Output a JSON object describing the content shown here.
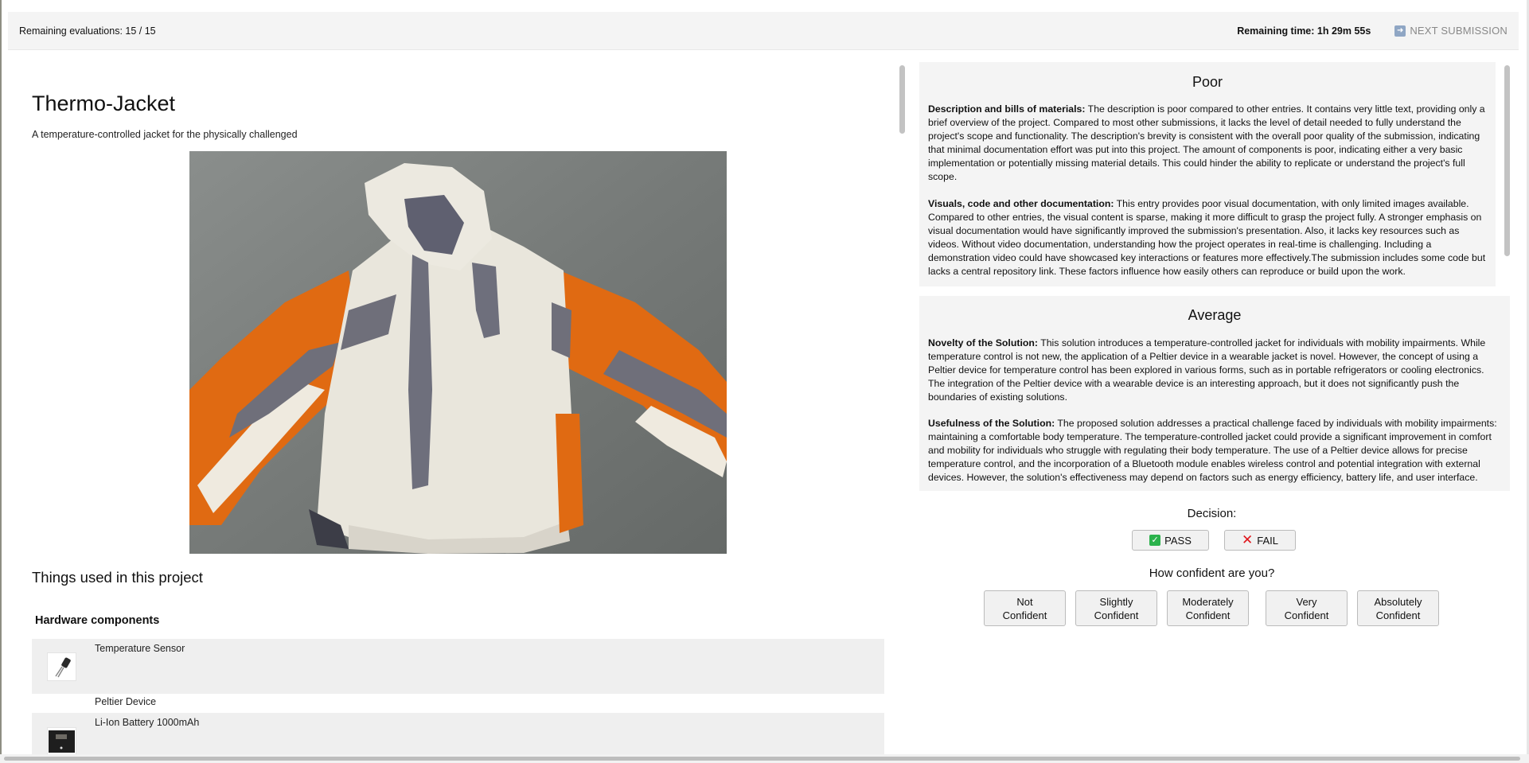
{
  "topbar": {
    "remaining_evaluations": "Remaining evaluations: 15 / 15",
    "remaining_time": "Remaining time: 1h 29m 55s",
    "next_submission": "NEXT SUBMISSION",
    "next_icon": "arrow-right-icon"
  },
  "project": {
    "title": "Thermo-Jacket",
    "subtitle": "A temperature-controlled jacket for the physically challenged",
    "things_title": "Things used in this project",
    "hardware_title": "Hardware components",
    "components": [
      {
        "name": "Temperature Sensor"
      },
      {
        "name": "Peltier Device"
      },
      {
        "name": "Li-Ion Battery 1000mAh"
      }
    ]
  },
  "reviews": {
    "poor": {
      "heading": "Poor",
      "p1_label": "Description and bills of materials:",
      "p1_text": " The description is poor compared to other entries. It contains very little text, providing only a brief overview of the project. Compared to most other submissions, it lacks the level of detail needed to fully understand the project's scope and functionality. The description's brevity is consistent with the overall poor quality of the submission, indicating that minimal documentation effort was put into this project. The amount of components is poor, indicating either a very basic implementation or potentially missing material details. This could hinder the ability to replicate or understand the project's full scope.",
      "p2_label": "Visuals, code and other documentation:",
      "p2_text": " This entry provides poor visual documentation, with only limited images available. Compared to other entries, the visual content is sparse, making it more difficult to grasp the project fully. A stronger emphasis on visual documentation would have significantly improved the submission's presentation. Also, it lacks key resources such as videos. Without video documentation, understanding how the project operates in real-time is challenging. Including a demonstration video could have showcased key interactions or features more effectively.The submission includes some code but lacks a central repository link. These factors influence how easily others can reproduce or build upon the work."
    },
    "average": {
      "heading": "Average",
      "p1_label": "Novelty of the Solution:",
      "p1_text": " This solution introduces a temperature-controlled jacket for individuals with mobility impairments. While temperature control is not new, the application of a Peltier device in a wearable jacket is novel. However, the concept of using a Peltier device for temperature control has been explored in various forms, such as in portable refrigerators or cooling electronics. The integration of the Peltier device with a wearable device is an interesting approach, but it does not significantly push the boundaries of existing solutions.",
      "p2_label": "Usefulness of the Solution:",
      "p2_text": " The proposed solution addresses a practical challenge faced by individuals with mobility impairments: maintaining a comfortable body temperature. The temperature-controlled jacket could provide a significant improvement in comfort and mobility for individuals who struggle with regulating their body temperature. The use of a Peltier device allows for precise temperature control, and the incorporation of a Bluetooth module enables wireless control and potential integration with external devices. However, the solution's effectiveness may depend on factors such as energy efficiency, battery life, and user interface."
    }
  },
  "decision": {
    "label": "Decision:",
    "pass": "PASS",
    "fail": "FAIL"
  },
  "confidence": {
    "label": "How confident are you?",
    "options": [
      {
        "line1": "Not",
        "line2": "Confident"
      },
      {
        "line1": "Slightly",
        "line2": "Confident"
      },
      {
        "line1": "Moderately",
        "line2": "Confident"
      },
      {
        "line1": "Very",
        "line2": "Confident"
      },
      {
        "line1": "Absolutely",
        "line2": "Confident"
      }
    ]
  },
  "colors": {
    "jacket_orange": "#e06a12",
    "jacket_white": "#e9e6dc",
    "jacket_grey": "#6f6f7a",
    "pass_green": "#2bb24c",
    "fail_red": "#e0151b"
  }
}
